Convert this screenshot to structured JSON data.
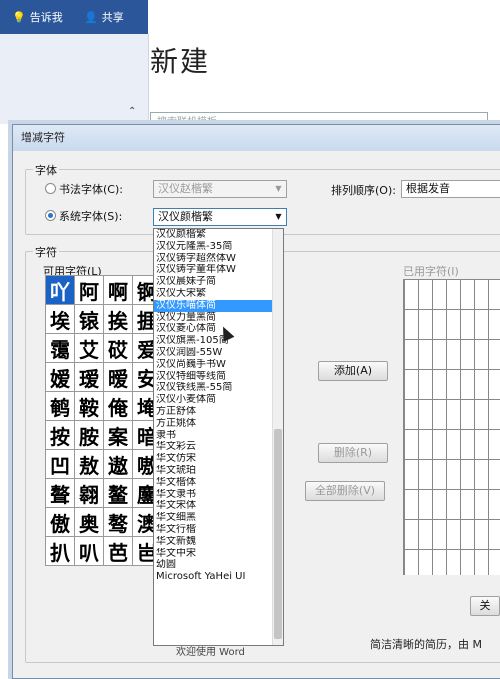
{
  "topbar": {
    "tell_me": "告诉我",
    "share": "共享"
  },
  "word": {
    "new_title": "新建",
    "search_placeholder": "搜索联机模板"
  },
  "dialog": {
    "title": "增减字符",
    "font_group": "字体",
    "calligraphy_label": "书法字体(C):",
    "calligraphy_value": "汉仪赵楷繁",
    "system_label": "系统字体(S):",
    "system_value": "汉仪颜楷繁",
    "sort_label": "排列顺序(O):",
    "sort_value": "根据发音",
    "chars_group": "字符",
    "available_label": "可用字符(L)",
    "used_label": "已用字符(I)",
    "add_button": "添加(A)",
    "delete_button": "删除(R)",
    "delete_all_button": "全部删除(V)",
    "close_button": "关",
    "available_chars": [
      "吖",
      "阿",
      "啊",
      "锕",
      "埃",
      "锿",
      "挨",
      "捱",
      "霭",
      "艾",
      "砹",
      "爱",
      "嫒",
      "瑷",
      "暧",
      "安",
      "鹌",
      "鞍",
      "俺",
      "埯",
      "按",
      "胺",
      "案",
      "暗",
      "凹",
      "敖",
      "遨",
      "嗷",
      "聱",
      "翱",
      "鳌",
      "鏖",
      "傲",
      "奥",
      "骜",
      "澳",
      "扒",
      "叭",
      "芭",
      "岜"
    ]
  },
  "dropdown": {
    "items": [
      "汉仪颜楷繁",
      "汉仪元隆黑-35简",
      "汉仪铸字超然体W",
      "汉仪铸字童年体W",
      "汉仪晨妹子简",
      "汉仪大宋繁",
      "汉仪乐喵体简",
      "汉仪力量黑简",
      "汉仪菱心体简",
      "汉仪旗黑-105简",
      "汉仪润圆-55W",
      "汉仪尚巍手书W",
      "汉仪特细等线简",
      "汉仪铁线黑-55简",
      "汉仪小麦体简",
      "方正舒体",
      "方正姚体",
      "隶书",
      "华文彩云",
      "华文仿宋",
      "华文琥珀",
      "华文楷体",
      "华文隶书",
      "华文宋体",
      "华文细黑",
      "华文行楷",
      "华文新魏",
      "华文中宋",
      "幼圆",
      "Microsoft YaHei UI"
    ],
    "highlighted_index": 6
  },
  "footer": {
    "welcome": "欢迎使用 Word",
    "tagline": "简洁清晰的简历，由 M"
  }
}
